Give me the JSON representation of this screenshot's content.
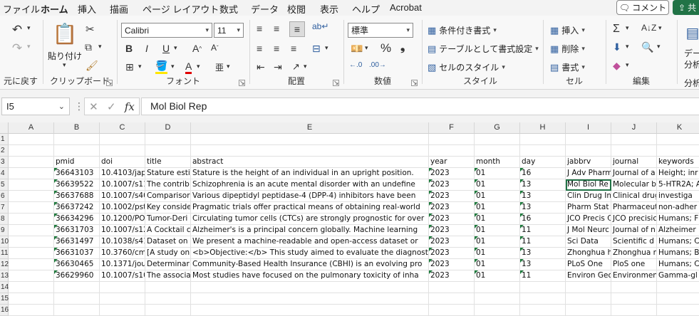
{
  "menu": {
    "tabs": [
      "ファイル",
      "ホーム",
      "挿入",
      "描画",
      "ページ レイアウト",
      "数式",
      "データ",
      "校閲",
      "表示",
      "ヘルプ",
      "Acrobat"
    ],
    "active": "ホーム",
    "comment": "コメント",
    "share": "共"
  },
  "ribbon": {
    "undo_group": "元に戻す",
    "clipboard": {
      "paste": "貼り付け",
      "label": "クリップボード"
    },
    "font": {
      "name": "Calibri",
      "size": "11",
      "label": "フォント"
    },
    "alignment": {
      "label": "配置"
    },
    "number": {
      "format": "標準",
      "label": "数値"
    },
    "styles": {
      "conditional": "条件付き書式",
      "table": "テーブルとして書式設定",
      "cell_styles": "セルのスタイル",
      "label": "スタイル"
    },
    "cells": {
      "insert": "挿入",
      "delete": "削除",
      "format": "書式",
      "label": "セル"
    },
    "editing": {
      "label": "編集"
    },
    "analyze": {
      "label1": "デー",
      "label2": "分析",
      "label3": "分析"
    }
  },
  "formula_bar": {
    "name_box": "I5",
    "formula": "Mol Biol Rep"
  },
  "grid": {
    "columns": [
      "A",
      "B",
      "C",
      "D",
      "E",
      "F",
      "G",
      "H",
      "I",
      "J",
      "K"
    ],
    "row_numbers": [
      "1",
      "2",
      "3",
      "4",
      "5",
      "6",
      "7",
      "8",
      "9",
      "10",
      "11",
      "12",
      "13",
      "14",
      "15",
      "16"
    ],
    "headers": [
      "pmid",
      "doi",
      "title",
      "abstract",
      "year",
      "month",
      "day",
      "jabbrv",
      "journal",
      "keywords"
    ],
    "rows": [
      [
        "36643103",
        "10.4103/jap",
        "Stature esti",
        "Stature is the height of an individual in an upright position.",
        "2023",
        "01",
        "16",
        "J Adv Pharm",
        "Journal of a",
        "Height; inr"
      ],
      [
        "36639522",
        "10.1007/s11",
        "The contrib",
        "Schizophrenia is an acute mental disorder with an undefine",
        "2023",
        "01",
        "13",
        "Mol Biol Re",
        "Molecular b",
        "5-HTR2A; A"
      ],
      [
        "36637688",
        "10.1007/s40",
        "Comparisor",
        "Various dipeptidyl peptidase-4 (DPP-4) inhibitors have been",
        "2023",
        "01",
        "13",
        "Clin Drug In",
        "Clinical drug",
        "investiga"
      ],
      [
        "36637242",
        "10.1002/pst",
        "Key conside",
        "Pragmatic trials offer practical means of obtaining real-world",
        "2023",
        "01",
        "13",
        "Pharm Stat",
        "Pharmaceut",
        "non-adher"
      ],
      [
        "36634296",
        "10.1200/PO.",
        "Tumor-Deri",
        "Circulating tumor cells (CTCs) are strongly prognostic for over",
        "2023",
        "01",
        "16",
        "JCO Precis C",
        "JCO precisic",
        "Humans; F"
      ],
      [
        "36631703",
        "10.1007/s12",
        "A Cocktail c",
        "Alzheimer's is a principal concern globally. Machine learning",
        "2023",
        "01",
        "11",
        "J Mol Neurc",
        "Journal of n",
        "Alzheimer"
      ],
      [
        "36631497",
        "10.1038/s41",
        "Dataset on",
        "We present a machine-readable and open-access dataset or",
        "2023",
        "01",
        "11",
        "Sci Data",
        "Scientific d",
        "Humans; C"
      ],
      [
        "36631037",
        "10.3760/cm",
        "[A study on",
        "<b>Objective:</b> This study aimed to evaluate the diagnost",
        "2023",
        "01",
        "13",
        "Zhonghua h",
        "Zhonghua n",
        "Humans; B"
      ],
      [
        "36630465",
        "10.1371/jou",
        "Determinar",
        "Community-Based Health Insurance (CBHI) is an evolving pro",
        "2023",
        "01",
        "13",
        "PLoS One",
        "PloS one",
        "Humans; C"
      ],
      [
        "36629960",
        "10.1007/s10",
        "The associa",
        "Most studies have focused on the pulmonary toxicity of inha",
        "2023",
        "01",
        "11",
        "Environ Geo",
        "Environmen",
        "Gamma-gl"
      ]
    ]
  }
}
